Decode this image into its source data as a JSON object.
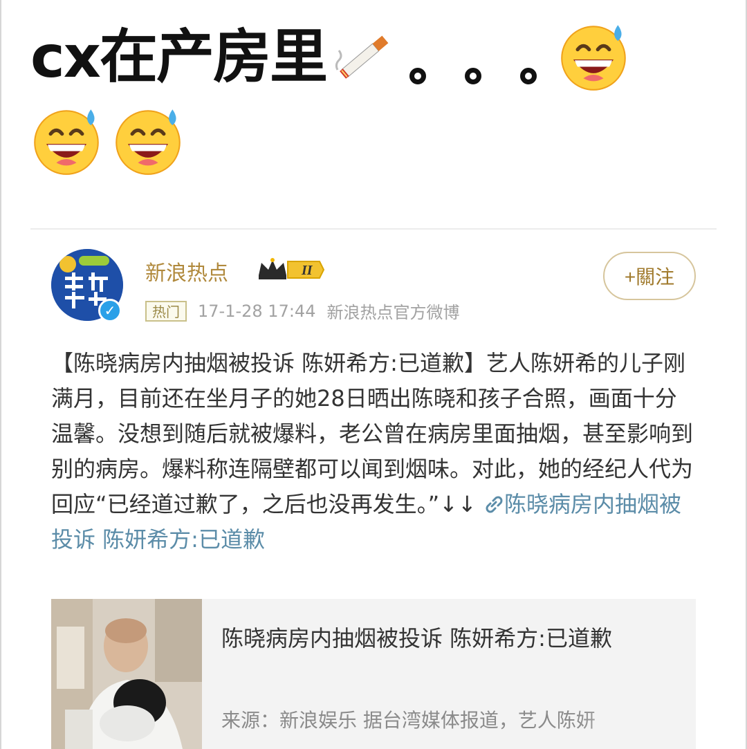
{
  "caption": {
    "text": "cx在产房里",
    "icon_after_text": "cigarette-icon",
    "dots": [
      "。",
      "。",
      "。"
    ],
    "emoji_name": "grinning-sweat-emoji",
    "emoji_count": 3
  },
  "post": {
    "username": "新浪热点",
    "badge_icon": "crown-level-badge-icon",
    "follow_label": "+關注",
    "hot_tag": "热门",
    "timestamp": "17-1-28 17:44",
    "source": "新浪热点官方微博",
    "body_text": "【陈晓病房内抽烟被投诉 陈妍希方:已道歉】艺人陈妍希的儿子刚满月，目前还在坐月子的她28日晒出陈晓和孩子合照，画面十分温馨。没想到随后就被爆料，老公曾在病房里面抽烟，甚至影响到别的病房。爆料称连隔壁都可以闻到烟味。对此，她的经纪人代为回应“已经道过歉了，之后也没再发生。”↓↓ ",
    "link_text": "陈晓病房内抽烟被投诉 陈妍希方:已道歉",
    "article": {
      "title": "陈晓病房内抽烟被投诉 陈妍希方:已道歉",
      "description": "来源：新浪娱乐 据台湾媒体报道，艺人陈妍"
    }
  },
  "colors": {
    "username": "#b0893c",
    "link": "#5b8ca8",
    "verified": "#2aa0e8",
    "avatar_bg": "#1e4fa8"
  }
}
